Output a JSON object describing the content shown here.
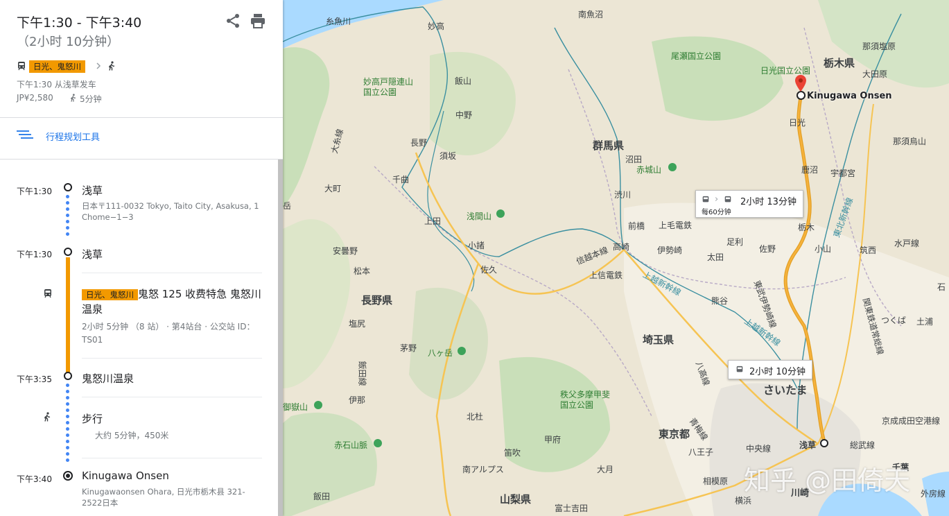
{
  "header": {
    "time_range": "下午1:30 - 下午3:40",
    "duration": "（2小时 10分钟）",
    "line_badge": "日光、鬼怒川",
    "depart_info": "下午1:30 从浅草发车",
    "fare": "JP¥2,580",
    "walk_time": "5分钟",
    "icons": [
      "share-icon",
      "print-icon",
      "train-icon",
      "chevron-right-icon",
      "walk-icon"
    ]
  },
  "planner": {
    "label": "行程规划工具",
    "icon": "lines-icon"
  },
  "steps": {
    "s1": {
      "time": "下午1:30",
      "name": "浅草",
      "address": "日本〒111-0032 Tokyo, Taito City, Asakusa, 1 Chome−1−3"
    },
    "s2": {
      "time": "下午1:30",
      "name": "浅草"
    },
    "transit": {
      "badge": "日光、鬼怒川",
      "title": "鬼怒 125 收费特急 鬼怒川温泉",
      "detail": "2小时 5分钟 （8 站） · 第4站台 · 公交站 ID：TS01"
    },
    "s3": {
      "time": "下午3:35",
      "name": "鬼怒川温泉"
    },
    "walk": {
      "title": "步行",
      "detail": "大约 5分钟，450米"
    },
    "s4": {
      "time": "下午3:40",
      "name": "Kinugawa Onsen",
      "address": "Kinugawaonsen Ohara, 日光市栃木县 321-2522日本"
    }
  },
  "map": {
    "callout_main": "2小时 10分钟",
    "callout_alt_time": "2小时 13分钟",
    "callout_alt_freq": "每60分钟",
    "destination": "Kinugawa Onsen",
    "watermark": "知乎 @田倚天",
    "labels": {
      "itoigawa": "糸魚川",
      "minamiuonuma": "南魚沼",
      "myoko": "妙高",
      "nasushiobara": "那須塩原",
      "oze": "尾瀬国立公園",
      "tochigi_ken": "栃木県",
      "nikko_park": "日光国立公園",
      "otawara": "大田原",
      "myoko_park": "妙高戸隠連山\n国立公園",
      "iiyama": "飯山",
      "nakano": "中野",
      "nikko": "日光",
      "nasukarasuyama": "那須烏山",
      "gunma_ken": "群馬県",
      "nagano": "長野",
      "suzaka": "須坂",
      "numata": "沼田",
      "akagi": "赤城山",
      "kanuma": "鹿沼",
      "utsunomiya": "宇都宮",
      "omachi": "大町",
      "chikuma": "千曲",
      "shibukawa": "渋川",
      "asama": "浅間山",
      "ueda": "上田",
      "maebashi": "前橋",
      "kamimo": "上毛電鉄",
      "tochigi": "栃木",
      "ashikaga": "足利",
      "sano": "佐野",
      "oyama": "小山",
      "chikusei": "筑西",
      "mitomo": "水戸線",
      "komoro": "小諸",
      "takasaki": "高崎",
      "isesaki": "伊勢崎",
      "ota": "太田",
      "azumino": "安曇野",
      "matsumoto": "松本",
      "saku": "佐久",
      "shinetsu": "信越本線",
      "joshin": "上信電鉄",
      "nagano_ken": "長野県",
      "kumagaya": "熊谷",
      "tsukuba": "つくば",
      "tsuchiura": "土浦",
      "shiojiri": "塩尻",
      "yatsugatake": "八ヶ岳",
      "saitama_ken": "埼玉県",
      "chino": "茅野",
      "chichibu": "秩父多摩甲斐\n国立公園",
      "saitama": "さいたま",
      "ontake": "御嶽山",
      "ina": "伊那",
      "hokuto": "北杜",
      "tokyo_to": "東京都",
      "narita": "京成成田空港線",
      "akaishi": "赤石山脈",
      "kofu": "甲府",
      "fuefuki": "笛吹",
      "hachioji": "八王子",
      "chuo": "中央線",
      "asakusa": "浅草",
      "sobu": "総武線",
      "chiba": "千葉",
      "minami_alps": "南アルプス",
      "otsuki": "大月",
      "sagamihara": "相模原",
      "kawasaki": "川崎",
      "iida": "飯田",
      "yamanashi_ken": "山梨県",
      "fujiyoshida": "富士吉田",
      "yokohama": "横浜",
      "gaibo": "外房線",
      "mito": "水戸線",
      "oarai": "石",
      "joetsu": "上越新幹線",
      "tohoku": "東北新幹線",
      "tobu": "東武伊勢崎線",
      "kanto": "関東鉄道常総線",
      "ome": "青梅線",
      "hachiko": "八高線",
      "iida_line": "飯田線",
      "oito": "大糸線",
      "kan": "岳"
    }
  }
}
